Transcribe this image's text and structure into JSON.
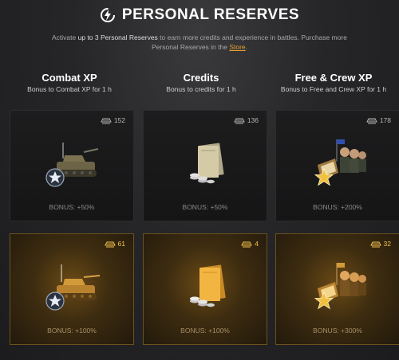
{
  "header": {
    "title": "PERSONAL RESERVES",
    "desc_part1": "Activate ",
    "desc_bold": "up to 3 Personal Reserves",
    "desc_part2": " to earn more credits and experience in battles. Purchase more Personal Reserves in the ",
    "desc_store": "Store",
    "desc_end": "."
  },
  "columns": [
    {
      "name": "Combat XP",
      "subtitle": "Bonus to Combat XP for 1 h",
      "icon": "tank-icon"
    },
    {
      "name": "Credits",
      "subtitle": "Bonus to credits for 1 h",
      "icon": "credits-book-icon"
    },
    {
      "name": "Free & Crew XP",
      "subtitle": "Bonus to Free and Crew XP for 1 h",
      "icon": "crew-icon"
    }
  ],
  "cards": [
    [
      {
        "count": "152",
        "bonus": "BONUS: +50%",
        "tier": "standard"
      },
      {
        "count": "61",
        "bonus": "BONUS: +100%",
        "tier": "gold"
      }
    ],
    [
      {
        "count": "136",
        "bonus": "BONUS: +50%",
        "tier": "standard"
      },
      {
        "count": "4",
        "bonus": "BONUS: +100%",
        "tier": "gold"
      }
    ],
    [
      {
        "count": "178",
        "bonus": "BONUS: +200%",
        "tier": "standard"
      },
      {
        "count": "32",
        "bonus": "BONUS: +300%",
        "tier": "gold"
      }
    ]
  ],
  "colors": {
    "accent": "#e8a030",
    "gold_count": "#f3c24b"
  }
}
